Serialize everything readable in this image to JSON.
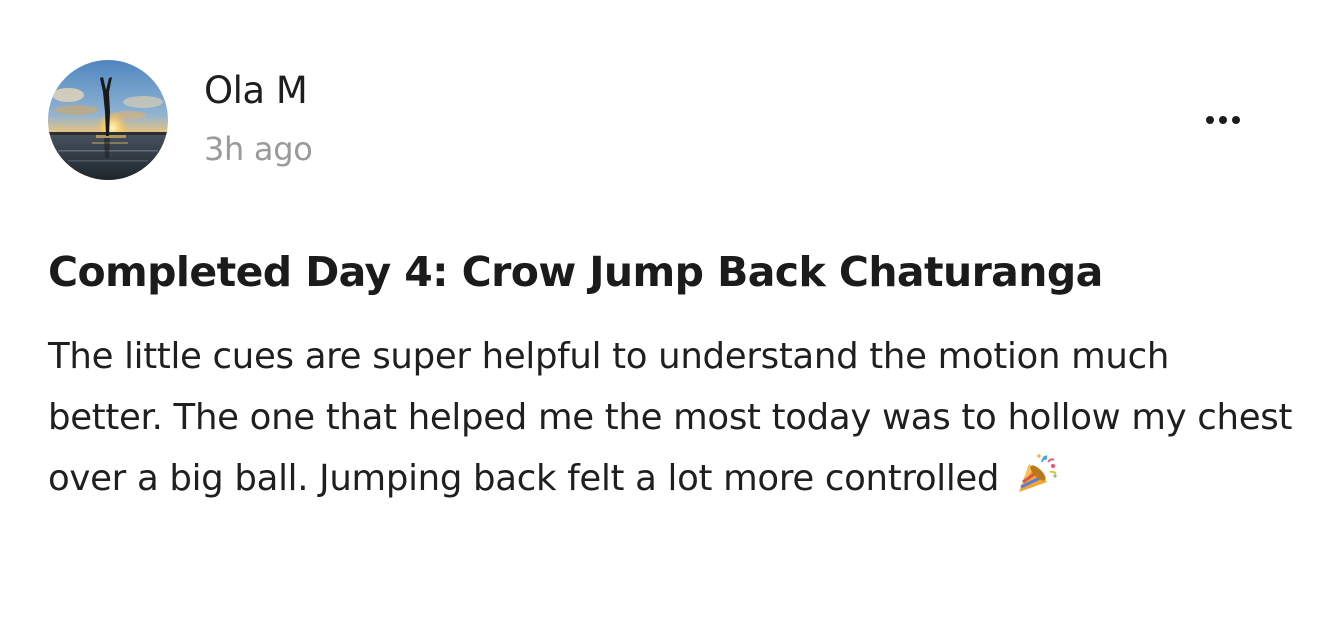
{
  "post": {
    "author": {
      "name": "Ola M",
      "time_ago": "3h ago"
    },
    "menu": {
      "icon": "more-horizontal-icon"
    },
    "title": "Completed Day 4: Crow Jump Back Chaturanga",
    "body": "The little cues are super helpful to understand the motion much better. The one that helped me the most today was to hollow my chest over a big ball. Jumping back felt a lot more controlled",
    "body_emoji": "party-popper-icon"
  }
}
